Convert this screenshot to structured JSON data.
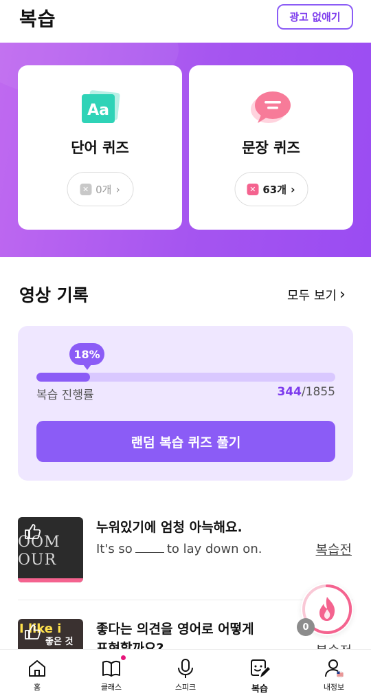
{
  "header": {
    "title": "복습",
    "ad_button": "광고 없애기"
  },
  "quiz_cards": {
    "word": {
      "label": "단어 퀴즈",
      "count": "0개"
    },
    "sentence": {
      "label": "문장 퀴즈",
      "count": "63개"
    }
  },
  "video_record": {
    "title": "영상 기록",
    "see_all": "모두 보기",
    "progress_percent": "18%",
    "progress_value": 0.18,
    "progress_label": "복습 진행률",
    "done": "344",
    "total": "/1855",
    "random_button": "랜덤 복습 퀴즈 풀기"
  },
  "items": [
    {
      "ko": "누워있기에 엄청 아늑해요.",
      "en_before": "It's so",
      "en_after": "to lay down on.",
      "status": "복습전",
      "thumb_text": "OOM\nOUR"
    },
    {
      "ko": "좋다는 의견을 영어로 어떻게",
      "ko2": "표현할까요?",
      "status": "복습전",
      "thumb_text": "I like i",
      "thumb_sub": "좋은 것"
    }
  ],
  "fire": {
    "count": "0"
  },
  "nav": {
    "home": "홈",
    "class": "클래스",
    "speak": "스피크",
    "review": "복습",
    "myinfo": "내정보"
  },
  "colors": {
    "accent": "#8b5cf6",
    "pink": "#f4638f",
    "banner": "#a555f0"
  }
}
